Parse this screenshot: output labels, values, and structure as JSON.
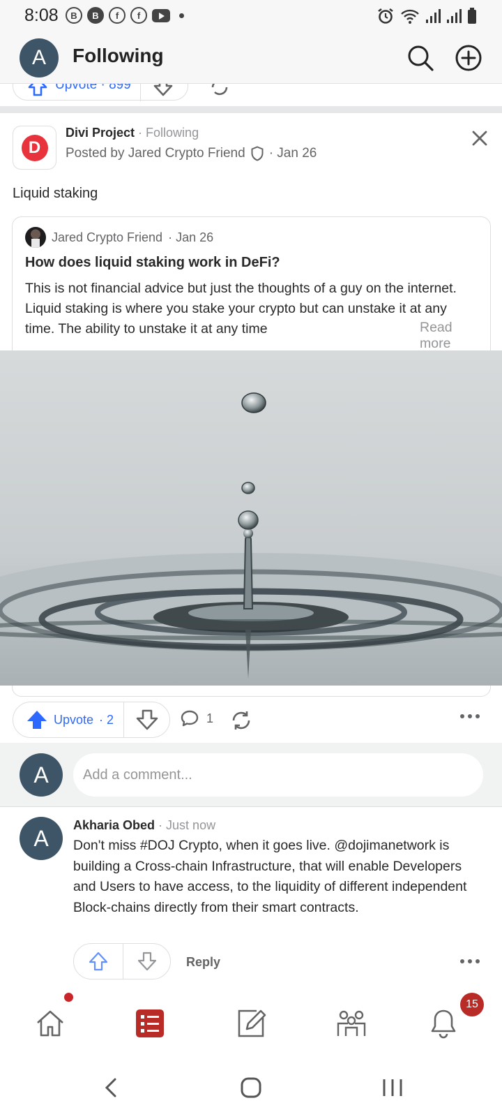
{
  "status_bar": {
    "time": "8:08",
    "notification_icons": [
      "b-circle-icon",
      "b-circle-filled-icon",
      "facebook-icon",
      "facebook-icon",
      "youtube-icon",
      "dot-icon"
    ],
    "system_icons": [
      "alarm-icon",
      "wifi-icon",
      "signal-icon",
      "signal-icon",
      "battery-icon"
    ]
  },
  "app_bar": {
    "avatar_letter": "A",
    "title": "Following"
  },
  "previous_post": {
    "partial_label": "Upvote · 899"
  },
  "post": {
    "space_logo_letter": "D",
    "space_name": "Divi Project",
    "follow_status": " · Following",
    "posted_by": "Posted by Jared Crypto Friend",
    "date": "· Jan 26",
    "text": "Liquid staking",
    "shared": {
      "author": "Jared Crypto Friend",
      "date": "· Jan 26",
      "title": "How does liquid staking work in DeFi?",
      "body": "This is not financial advice but just the thoughts of a guy on the internet. Liquid staking is where you stake your crypto but can unstake it at any time. The ability to unstake it at any time",
      "read_more": "Read more"
    },
    "actions": {
      "upvote_label": "Upvote",
      "upvote_count": "· 2",
      "comment_count": "1"
    }
  },
  "comment_box": {
    "avatar_letter": "A",
    "placeholder": "Add a comment..."
  },
  "comment": {
    "avatar_letter": "A",
    "author": "Akharia Obed",
    "time": " · Just now",
    "body": "Don't miss #DOJ Crypto, when it goes live. @dojimanetwork is building a Cross-chain Infrastructure, that will enable Developers and Users to have access, to the liquidity of different independent Block-chains directly from their smart contracts.",
    "reply_label": "Reply"
  },
  "bottom_nav": {
    "items": [
      "home-icon",
      "following-icon",
      "write-icon",
      "spaces-icon",
      "notifications-icon"
    ],
    "notification_badge": "15",
    "accent_color": "#b92b27"
  },
  "colors": {
    "link_blue": "#2e69ff",
    "avatar_bg": "#3d5566",
    "divi_red": "#e8323c"
  }
}
